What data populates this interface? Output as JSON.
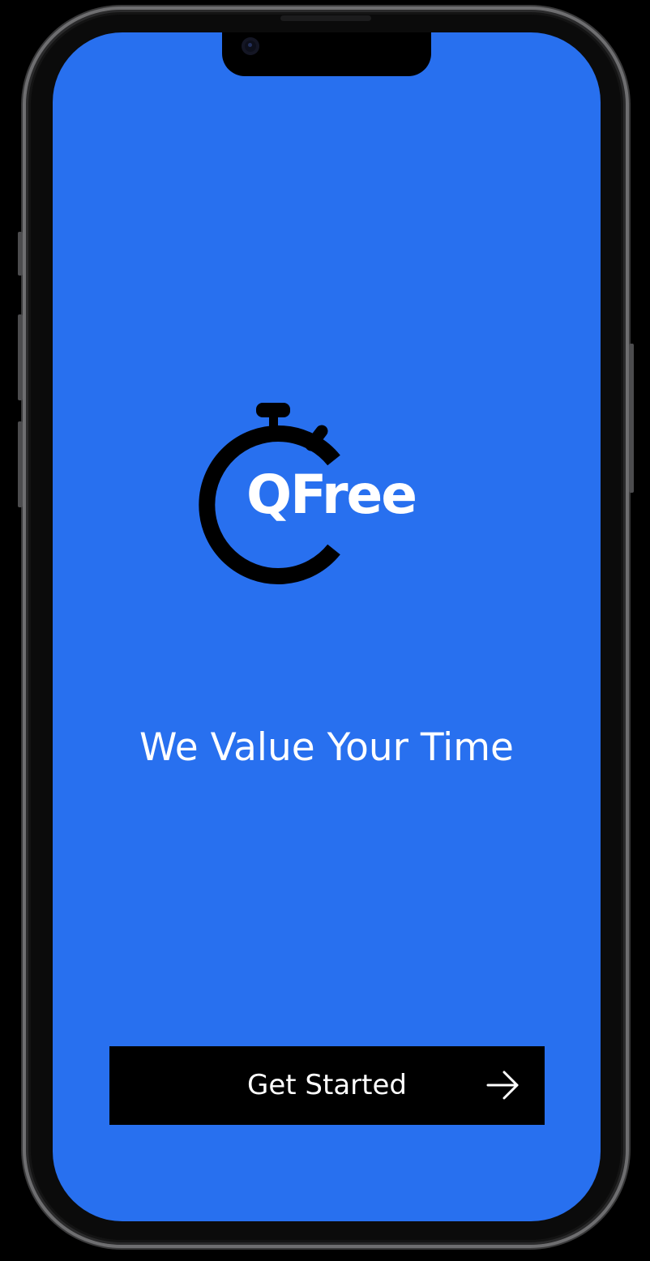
{
  "app": {
    "name": "QFree",
    "tagline": "We Value Your Time"
  },
  "logo": {
    "icon": "stopwatch-icon",
    "text": "QFree"
  },
  "cta": {
    "label": "Get Started",
    "icon": "arrow-right-icon"
  },
  "colors": {
    "screen_background": "#2870ef",
    "button_background": "#000000",
    "text": "#ffffff",
    "logo_mark": "#000000"
  }
}
